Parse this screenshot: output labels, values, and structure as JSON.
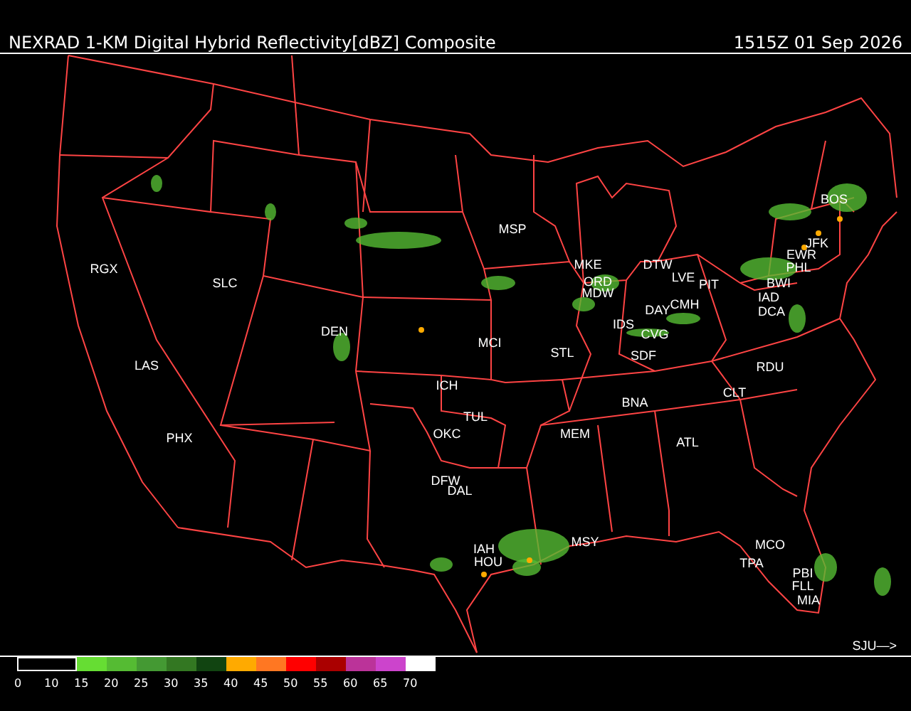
{
  "header": {
    "title": "NEXRAD 1-KM Digital Hybrid Reflectivity[dBZ] Composite",
    "timestamp": "1515Z 01 Sep 2026"
  },
  "stations": [
    {
      "label": "RGX"
    },
    {
      "label": "SLC"
    },
    {
      "label": "DEN"
    },
    {
      "label": "LAS"
    },
    {
      "label": "PHX"
    },
    {
      "label": "MSP"
    },
    {
      "label": "MKE"
    },
    {
      "label": "ORD"
    },
    {
      "label": "MDW"
    },
    {
      "label": "DTW"
    },
    {
      "label": "LVE"
    },
    {
      "label": "PIT"
    },
    {
      "label": "DAY"
    },
    {
      "label": "CMH"
    },
    {
      "label": "IDS"
    },
    {
      "label": "CVG"
    },
    {
      "label": "SDF"
    },
    {
      "label": "STL"
    },
    {
      "label": "MCI"
    },
    {
      "label": "ICH"
    },
    {
      "label": "TUL"
    },
    {
      "label": "OKC"
    },
    {
      "label": "DFW"
    },
    {
      "label": "DAL"
    },
    {
      "label": "BNA"
    },
    {
      "label": "MEM"
    },
    {
      "label": "ATL"
    },
    {
      "label": "CLT"
    },
    {
      "label": "RDU"
    },
    {
      "label": "BOS"
    },
    {
      "label": "JFK"
    },
    {
      "label": "EWR"
    },
    {
      "label": "PHL"
    },
    {
      "label": "BWI"
    },
    {
      "label": "IAD"
    },
    {
      "label": "DCA"
    },
    {
      "label": "IAH"
    },
    {
      "label": "HOU"
    },
    {
      "label": "MSY"
    },
    {
      "label": "MCO"
    },
    {
      "label": "TPA"
    },
    {
      "label": "PBI"
    },
    {
      "label": "FLL"
    },
    {
      "label": "MIA"
    }
  ],
  "offmap_label": "SJU—>",
  "legend": {
    "bins": [
      {
        "color": "#000000"
      },
      {
        "color": "#66dd33"
      },
      {
        "color": "#55bb33"
      },
      {
        "color": "#449933"
      },
      {
        "color": "#337722"
      },
      {
        "color": "#114411"
      },
      {
        "color": "#ffaa00"
      },
      {
        "color": "#ff7722"
      },
      {
        "color": "#ff0000"
      },
      {
        "color": "#aa0000"
      },
      {
        "color": "#bb3399"
      },
      {
        "color": "#cc44cc"
      },
      {
        "color": "#ffffff"
      }
    ],
    "ticks": [
      "0",
      "10",
      "15",
      "20",
      "25",
      "30",
      "35",
      "40",
      "45",
      "50",
      "55",
      "60",
      "65",
      "70"
    ]
  }
}
